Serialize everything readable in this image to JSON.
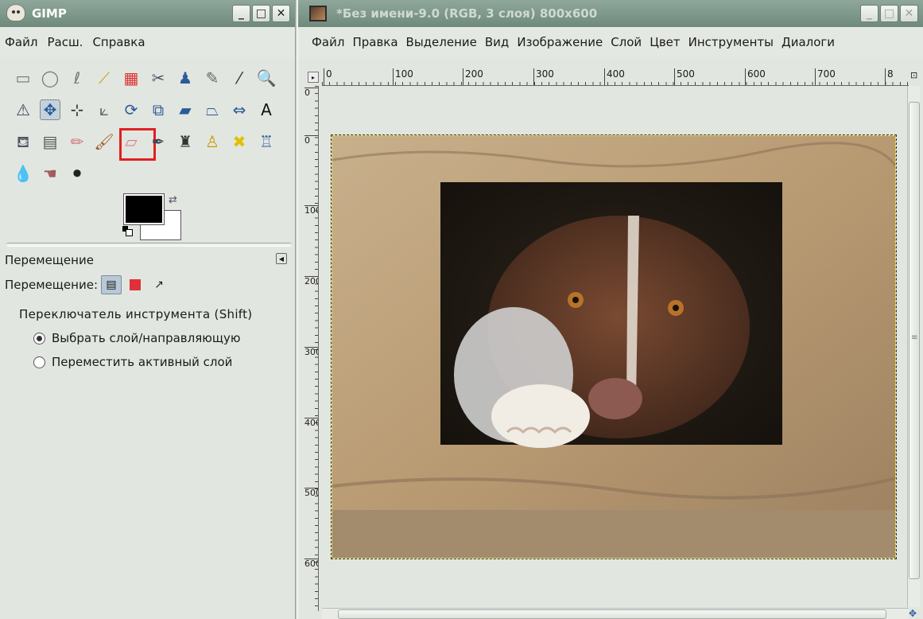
{
  "toolbox": {
    "title": "GIMP",
    "menu": [
      "Файл",
      "Расш.",
      "Справка"
    ],
    "tools": [
      {
        "name": "rect-select-icon",
        "glyph": "▭",
        "color": "#777"
      },
      {
        "name": "ellipse-select-icon",
        "glyph": "◯",
        "color": "#777"
      },
      {
        "name": "free-select-icon",
        "glyph": "ℓ",
        "color": "#777"
      },
      {
        "name": "fuzzy-select-icon",
        "glyph": "⟋",
        "color": "#c7a000"
      },
      {
        "name": "select-by-color-icon",
        "glyph": "▦",
        "color": "#d33"
      },
      {
        "name": "scissors-select-icon",
        "glyph": "✂",
        "color": "#556"
      },
      {
        "name": "foreground-select-icon",
        "glyph": "♟",
        "color": "#2b5c9a"
      },
      {
        "name": "paths-icon",
        "glyph": "✎",
        "color": "#666"
      },
      {
        "name": "color-picker-icon",
        "glyph": "⁄",
        "color": "#333"
      },
      {
        "name": "zoom-icon",
        "glyph": "🔍",
        "color": "#2a5b9a"
      },
      {
        "name": "measure-icon",
        "glyph": "⚠",
        "color": "#445"
      },
      {
        "name": "move-icon",
        "glyph": "✥",
        "color": "#2a5b9a",
        "active": true
      },
      {
        "name": "align-icon",
        "glyph": "⊹",
        "color": "#333"
      },
      {
        "name": "crop-icon",
        "glyph": "⟀",
        "color": "#666"
      },
      {
        "name": "rotate-icon",
        "glyph": "⟳",
        "color": "#2a5b9a"
      },
      {
        "name": "scale-icon",
        "glyph": "⧉",
        "color": "#2a5b9a"
      },
      {
        "name": "shear-icon",
        "glyph": "▰",
        "color": "#2a5b9a"
      },
      {
        "name": "perspective-icon",
        "glyph": "⏢",
        "color": "#2a5b9a"
      },
      {
        "name": "flip-icon",
        "glyph": "⇔",
        "color": "#2a5b9a"
      },
      {
        "name": "text-icon",
        "glyph": "A",
        "color": "#111"
      },
      {
        "name": "bucket-fill-icon",
        "glyph": "⛾",
        "color": "#556"
      },
      {
        "name": "blend-icon",
        "glyph": "▤",
        "color": "#555"
      },
      {
        "name": "pencil-icon",
        "glyph": "✏",
        "color": "#c77"
      },
      {
        "name": "paintbrush-icon",
        "glyph": "🖌",
        "color": "#a05a2a"
      },
      {
        "name": "eraser-icon",
        "glyph": "▱",
        "color": "#e07c8a",
        "highlighted": true
      },
      {
        "name": "airbrush-icon",
        "glyph": "✒",
        "color": "#445"
      },
      {
        "name": "ink-icon",
        "glyph": "♜",
        "color": "#333"
      },
      {
        "name": "clone-icon",
        "glyph": "♙",
        "color": "#c7a000"
      },
      {
        "name": "heal-icon",
        "glyph": "✖",
        "color": "#e0c000"
      },
      {
        "name": "perspective-clone-icon",
        "glyph": "♖",
        "color": "#2a5b9a"
      },
      {
        "name": "blur-icon",
        "glyph": "💧",
        "color": "#2a5b9a"
      },
      {
        "name": "smudge-icon",
        "glyph": "☚",
        "color": "#a05a5a"
      },
      {
        "name": "dodge-burn-icon",
        "glyph": "⚫",
        "color": "#222"
      }
    ],
    "options": {
      "title": "Перемещение",
      "move_label": "Перемещение:",
      "switch_label": "Переключатель инструмента  (Shift)",
      "radio_pick": "Выбрать слой/направляющую",
      "radio_move": "Переместить активный слой"
    }
  },
  "image_window": {
    "title": "*Без имени-9.0 (RGB, 3 слоя) 800x600",
    "menu": [
      "Файл",
      "Правка",
      "Выделение",
      "Вид",
      "Изображение",
      "Слой",
      "Цвет",
      "Инструменты",
      "Диалоги"
    ],
    "hruler_labels": [
      "0",
      "100",
      "200",
      "300",
      "400",
      "500",
      "600",
      "700",
      "8"
    ],
    "vruler_labels": [
      "0",
      "0",
      "100",
      "200",
      "300",
      "400",
      "500",
      "600"
    ]
  }
}
